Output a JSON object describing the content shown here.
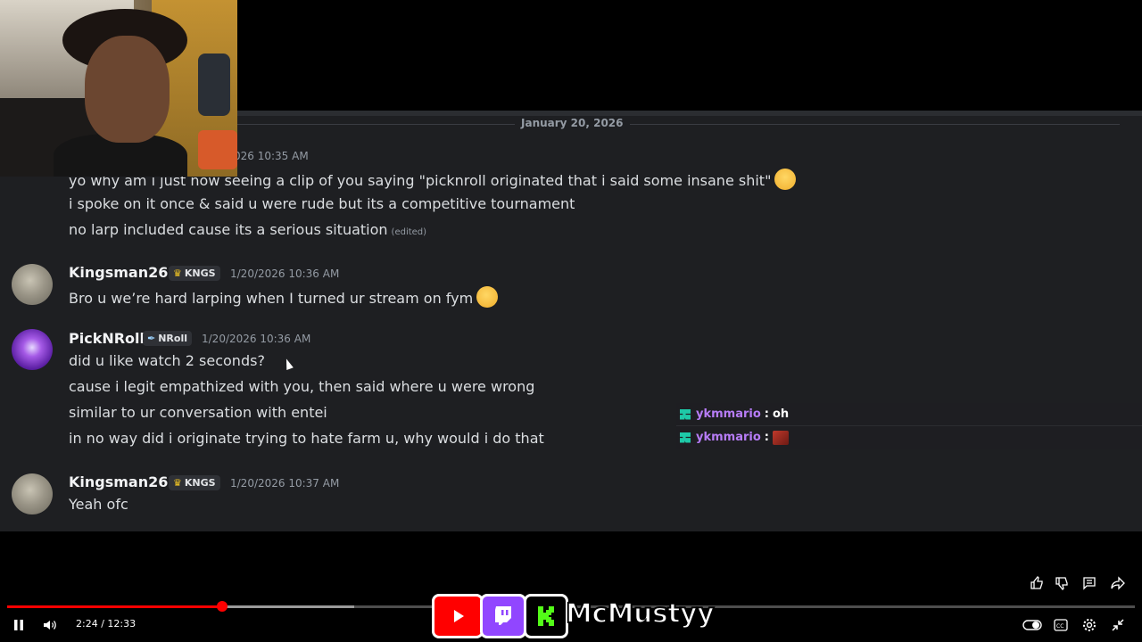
{
  "discord": {
    "date_divider": "January 20, 2026",
    "first_group": {
      "timestamp_partial": "026 10:35 AM",
      "lines": [
        "yo why am i just now seeing a clip of you saying \"picknroll originated that i said some insane shit\"",
        "i spoke on it once & said u were rude but its a competitive tournament",
        "no larp included cause its a serious situation"
      ],
      "edited_label": "(edited)"
    },
    "messages": [
      {
        "author": "Kingsman265",
        "tag": "KNGS",
        "tag_icon": "crown-icon",
        "timestamp": "1/20/2026 10:36 AM",
        "lines": [
          "Bro u we’re hard larping when I turned ur stream on fym"
        ]
      },
      {
        "author": "PickNRoll",
        "tag": "NRoll",
        "tag_icon": "syringe-icon",
        "timestamp": "1/20/2026 10:36 AM",
        "lines": [
          "did u like watch 2 seconds?",
          "cause i legit empathized with you, then said where u were wrong",
          "similar to ur conversation with entei",
          "in no way did i originate trying to hate farm u, why would i do that"
        ]
      },
      {
        "author": "Kingsman265",
        "tag": "KNGS",
        "tag_icon": "crown-icon",
        "timestamp": "1/20/2026 10:37 AM",
        "lines": [
          "Yeah ofc"
        ]
      }
    ]
  },
  "chat_overlay": [
    {
      "user": "ykmmario",
      "separator": ":",
      "text": "oh"
    },
    {
      "user": "ykmmario",
      "separator": ":",
      "text": ""
    }
  ],
  "player": {
    "time_current": "2:24",
    "time_total": "12:33",
    "time_display": "2:24 / 12:33",
    "progress_played": 0.191,
    "progress_buffered": 0.308,
    "accent_color": "#ff0000",
    "brand_name": "McMustyy",
    "brand_icons": [
      "youtube-icon",
      "twitch-icon",
      "kick-icon"
    ]
  }
}
